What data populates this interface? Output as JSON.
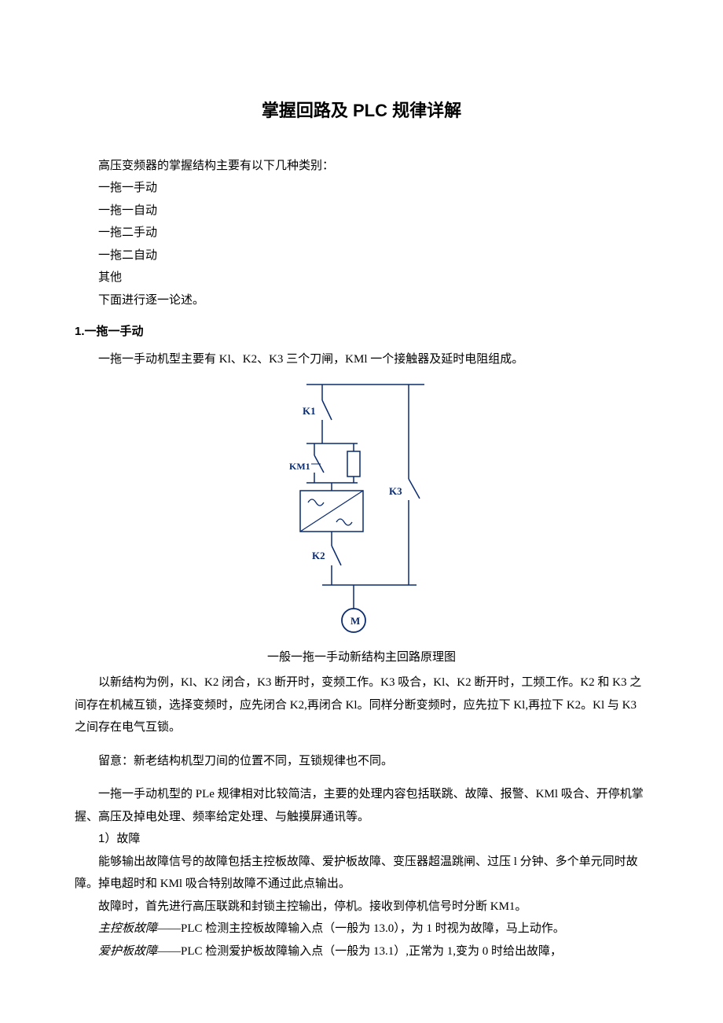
{
  "title": "掌握回路及 PLC 规律详解",
  "intro": {
    "line1": "高压变频器的掌握结构主要有以下几种类别：",
    "items": [
      "一拖一手动",
      "一拖一自动",
      "一拖二手动",
      "一拖二自动",
      "其他"
    ],
    "line2": "下面进行逐一论述。"
  },
  "section1": {
    "heading": "1.一拖一手动",
    "p1": "一拖一手动机型主要有 Kl、K2、K3 三个刀闸，KMl 一个接触器及延时电阻组成。",
    "caption": "一般一拖一手动新结构主回路原理图",
    "p2": "以新结构为例，Kl、K2 闭合，K3 断开时，变频工作。K3 吸合，Kl、K2 断开时，工频工作。K2 和 K3 之间存在机械互锁，选择变频时，应先闭合 K2,再闭合 Kl。同样分断变频时，应先拉下 Kl,再拉下 K2。Kl 与 K3 之间存在电气互锁。",
    "p3": "留意：新老结构机型刀间的位置不同，互锁规律也不同。",
    "p4": "一拖一手动机型的 PLe 规律相对比较简洁，主要的处理内容包括联跳、故障、报警、KMl 吸合、开停机掌握、高压及掉电处理、频率给定处理、与触摸屏通讯等。",
    "sub1_h": "1）故障",
    "sub1_p1": "能够输出故障信号的故障包括主控板故障、爱护板故障、变压器超温跳闸、过压 l 分钟、多个单元同时故障。掉电超时和 KMl 吸合特别故障不通过此点输出。",
    "sub1_p2": "故障时，首先进行高压联跳和封锁主控输出，停机。接收到停机信号时分断 KM1。",
    "sub1_p3_label": "主控板故障",
    "sub1_p3_body": "——PLC 检测主控板故障输入点（一般为 13.0），为 1 时视为故障，马上动作。",
    "sub1_p4_label": "爱护板故障",
    "sub1_p4_body": "——PLC 检测爱护板故障输入点（一般为 13.1）,正常为 1,变为 0 时给出故障，"
  },
  "diagram": {
    "k1": "K1",
    "km1": "KM1",
    "k2": "K2",
    "k3": "K3",
    "motor": "M"
  }
}
